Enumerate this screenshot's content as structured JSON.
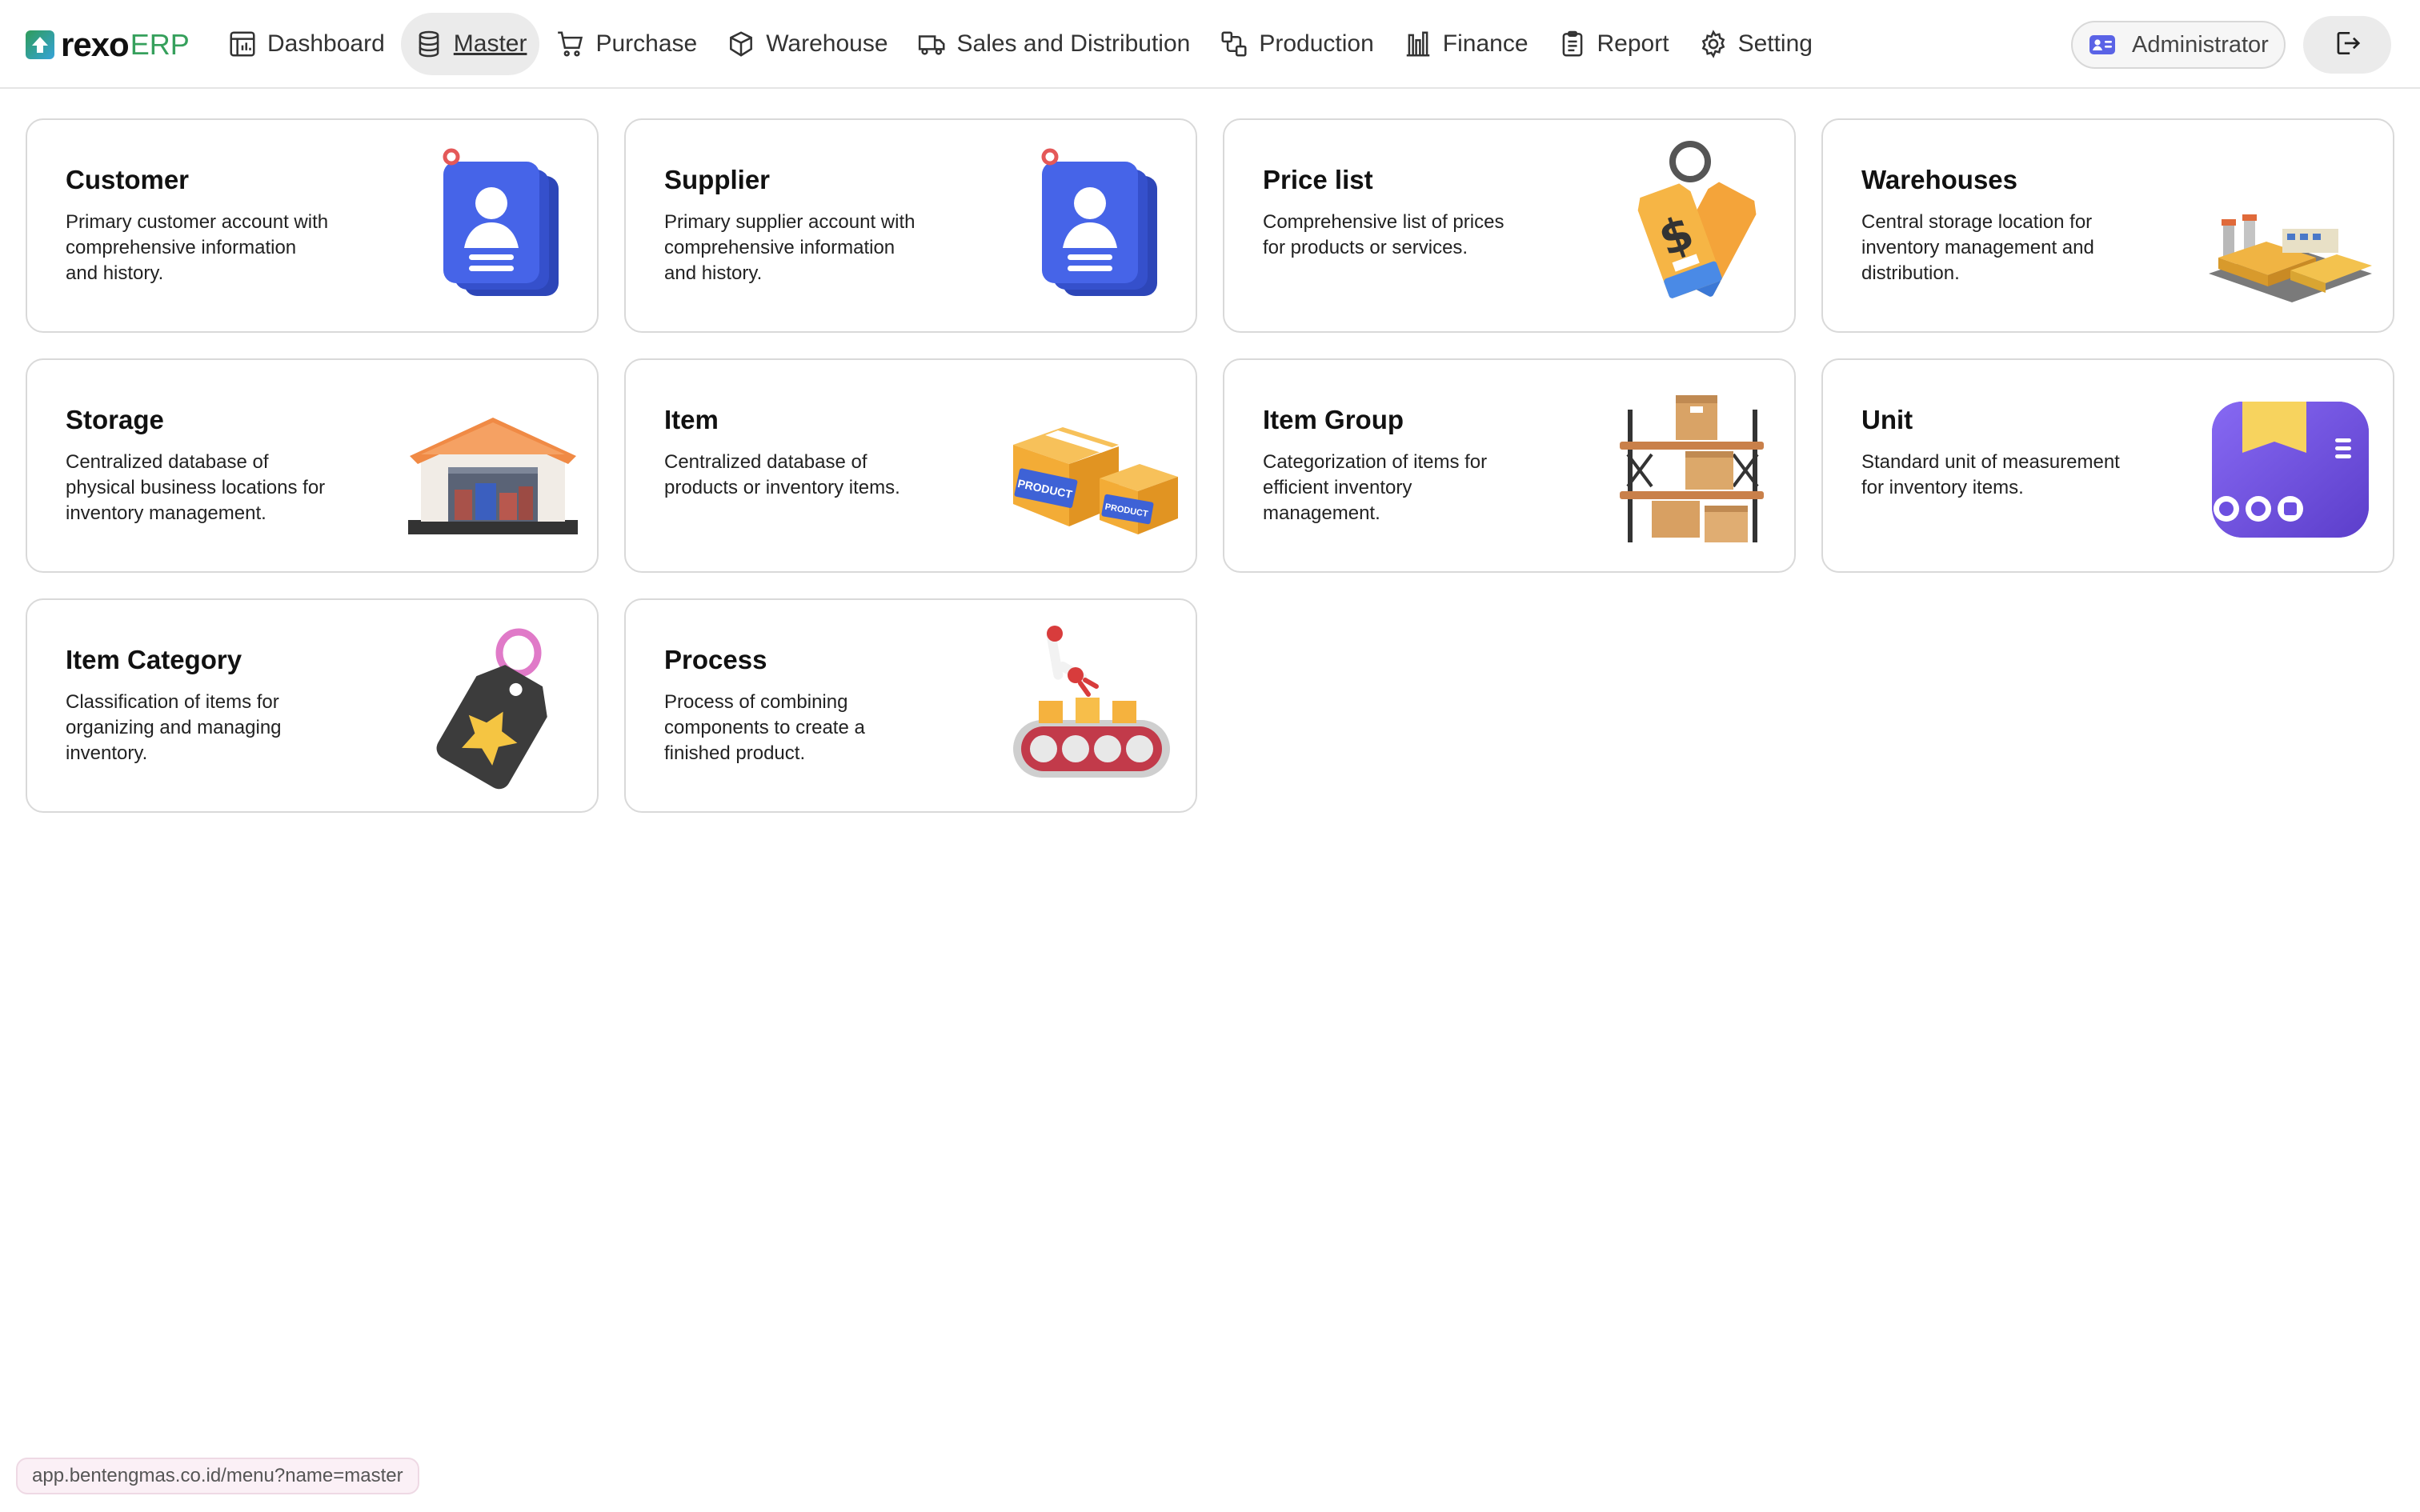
{
  "app": {
    "brand_main": "rexo",
    "brand_suffix": "ERP"
  },
  "nav": {
    "items": [
      {
        "label": "Dashboard",
        "icon": "dashboard-icon"
      },
      {
        "label": "Master",
        "icon": "database-icon",
        "active": true
      },
      {
        "label": "Purchase",
        "icon": "cart-icon"
      },
      {
        "label": "Warehouse",
        "icon": "box-icon"
      },
      {
        "label": "Sales and Distribution",
        "icon": "truck-icon"
      },
      {
        "label": "Production",
        "icon": "workflow-icon"
      },
      {
        "label": "Finance",
        "icon": "bar-chart-icon"
      },
      {
        "label": "Report",
        "icon": "clipboard-icon"
      },
      {
        "label": "Setting",
        "icon": "gear-icon"
      }
    ],
    "user_label": "Administrator",
    "user_icon": "id-card-icon",
    "logout_icon": "logout-icon"
  },
  "cards": [
    {
      "title": "Customer",
      "desc": "Primary customer account with comprehensive information and history.",
      "art": "contact-card-icon"
    },
    {
      "title": "Supplier",
      "desc": "Primary supplier account with comprehensive information and history.",
      "art": "contact-card-icon"
    },
    {
      "title": "Price list",
      "desc": "Comprehensive list of prices for products or services.",
      "art": "price-tag-icon"
    },
    {
      "title": "Warehouses",
      "desc": "Central storage location for inventory management and distribution.",
      "art": "factory-icon"
    },
    {
      "title": "Storage",
      "desc": "Centralized database of physical business locations for inventory management.",
      "art": "storehouse-icon"
    },
    {
      "title": "Item",
      "desc": "Centralized database of products or inventory items.",
      "art": "product-boxes-icon",
      "art_text": "PRODUCT"
    },
    {
      "title": "Item Group",
      "desc": "Categorization of items for efficient inventory management.",
      "art": "shelf-boxes-icon"
    },
    {
      "title": "Unit",
      "desc": "Standard unit of measurement for inventory items.",
      "art": "unit-box-icon"
    },
    {
      "title": "Item Category",
      "desc": "Classification of items for organizing and managing inventory.",
      "art": "star-tag-icon"
    },
    {
      "title": "Process",
      "desc": "Process of combining components to create a finished product.",
      "art": "conveyor-icon"
    }
  ],
  "status_url": "app.bentengmas.co.id/menu?name=master",
  "colors": {
    "accent": "#36a05c",
    "card_border": "#d9d9d9",
    "active_nav_bg": "#ebebeb"
  }
}
